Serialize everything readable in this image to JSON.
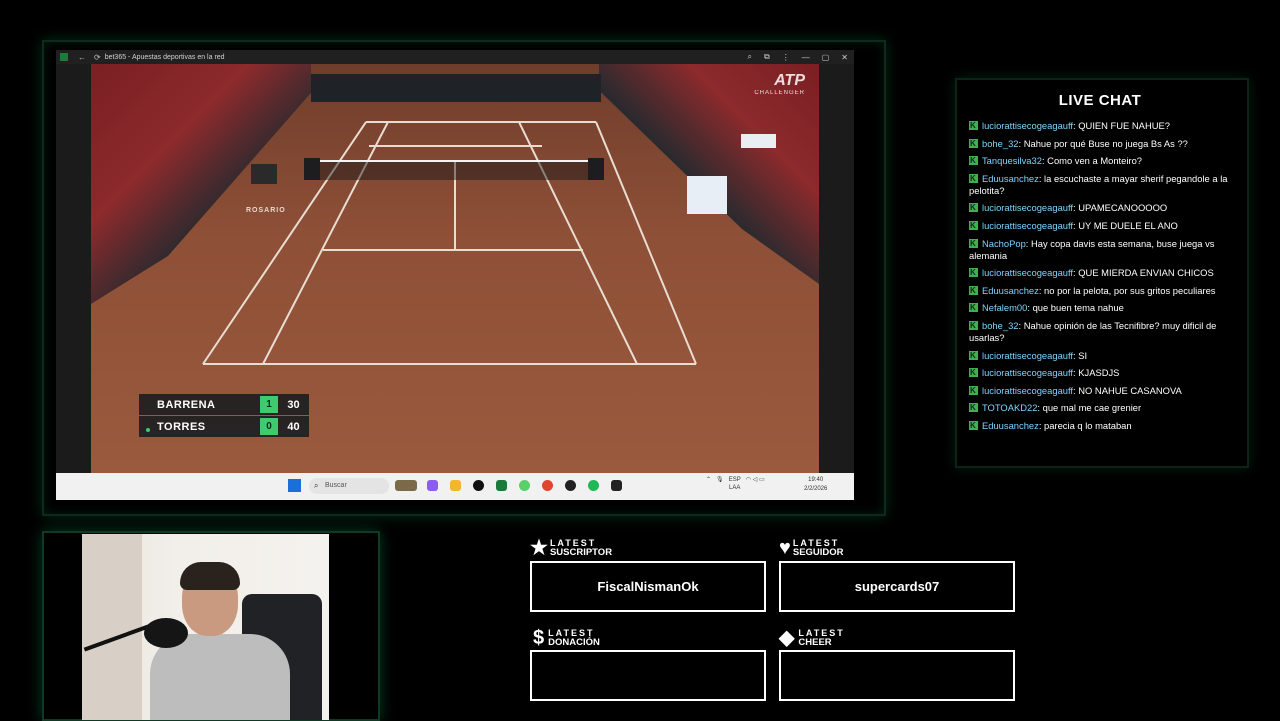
{
  "browser": {
    "tab_title": "bet365 - Apuestas deportivas en la red",
    "window_controls": [
      "—",
      "▢",
      "✕"
    ]
  },
  "stream": {
    "broadcast_logo": "ATP",
    "broadcast_sub": "CHALLENGER",
    "venue_text": "ROSARIO"
  },
  "scoreboard": {
    "players": [
      {
        "name": "BARRENA",
        "sets": "1",
        "points": "30",
        "serving": false
      },
      {
        "name": "TORRES",
        "sets": "0",
        "points": "40",
        "serving": true
      }
    ]
  },
  "taskbar": {
    "search_placeholder": "Buscar",
    "language_top": "ESP",
    "language_bottom": "LAA",
    "time": "19:40",
    "date": "2/2/2026"
  },
  "chat": {
    "title": "LIVE CHAT",
    "messages": [
      {
        "user": "luciorattisecogeagauff",
        "text": "QUIEN FUE NAHUE?"
      },
      {
        "user": "bohe_32",
        "text": "Nahue por qué Buse no juega Bs As ??"
      },
      {
        "user": "Tanquesilva32",
        "text": "Como ven a Monteiro?"
      },
      {
        "user": "Eduusanchez",
        "text": "la escuchaste a mayar sherif pegandole a la pelotita?"
      },
      {
        "user": "luciorattisecogeagauff",
        "text": "UPAMECANOOOOO"
      },
      {
        "user": "luciorattisecogeagauff",
        "text": "UY ME DUELE EL ANO"
      },
      {
        "user": "NachoPop",
        "text": "Hay copa davis esta semana, buse juega vs alemania"
      },
      {
        "user": "luciorattisecogeagauff",
        "text": "QUE MIERDA ENVIAN CHICOS"
      },
      {
        "user": "Eduusanchez",
        "text": "no por la pelota, por sus gritos peculiares"
      },
      {
        "user": "Nefalem00",
        "text": "que buen tema nahue"
      },
      {
        "user": "bohe_32",
        "text": "Nahue opinión de las Tecnifibre? muy dificil de usarlas?"
      },
      {
        "user": "luciorattisecogeagauff",
        "text": "SI"
      },
      {
        "user": "luciorattisecogeagauff",
        "text": "KJASDJS"
      },
      {
        "user": "luciorattisecogeagauff",
        "text": "NO NAHUE CASANOVA"
      },
      {
        "user": "TOTOAKD22",
        "text": "que mal me cae grenier"
      },
      {
        "user": "Eduusanchez",
        "text": "parecia q lo mataban"
      }
    ]
  },
  "widgets": {
    "subscriber": {
      "line1": "LATEST",
      "line2": "SUSCRIPTOR",
      "value": "FiscalNismanOk",
      "icon": "star-icon"
    },
    "follower": {
      "line1": "LATEST",
      "line2": "SEGUIDOR",
      "value": "supercards07",
      "icon": "heart-icon"
    },
    "donation": {
      "line1": "LATEST",
      "line2": "DONACIÓN",
      "value": "",
      "icon": "dollar-icon"
    },
    "cheer": {
      "line1": "LATEST",
      "line2": "CHEER",
      "value": "",
      "icon": "diamond-icon"
    }
  },
  "colors": {
    "accent_green": "#3ecb6e",
    "chat_username": "#7fd4ff",
    "frame_glow": "#0e3a26"
  }
}
